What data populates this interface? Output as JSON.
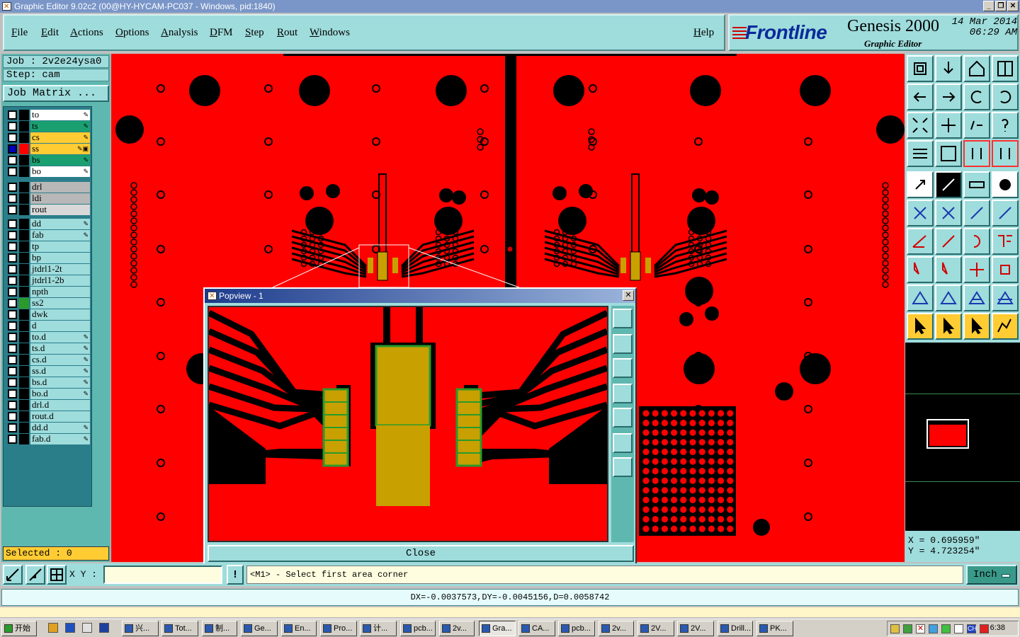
{
  "window": {
    "title": "Graphic Editor 9.02c2 (00@HY-HYCAM-PC037 - Windows, pid:1840)"
  },
  "menu": [
    "File",
    "Edit",
    "Actions",
    "Options",
    "Analysis",
    "DFM",
    "Step",
    "Rout",
    "Windows"
  ],
  "menu_help": "Help",
  "brand": {
    "logo": "Frontline",
    "product": "Genesis 2000",
    "subtitle": "Graphic Editor",
    "date": "14 Mar 2014",
    "time": "06:29 AM"
  },
  "job": {
    "job_line": "Job : 2v2e24ysa0",
    "step_line": "Step: cam",
    "matrix_button": "Job Matrix ..."
  },
  "layers": [
    {
      "name": "to",
      "color": "#ffffff",
      "swatch": "#000000",
      "mark": "✎"
    },
    {
      "name": "ts",
      "color": "#1aa070",
      "swatch": "#000000",
      "mark": "✎"
    },
    {
      "name": "cs",
      "color": "#ffcc33",
      "swatch": "#000000",
      "mark": "✎"
    },
    {
      "name": "ss",
      "color": "#ffcc33",
      "swatch": "#ff0000",
      "mark": "✎▣",
      "active": true
    },
    {
      "name": "bs",
      "color": "#1aa070",
      "swatch": "#000000",
      "mark": "✎"
    },
    {
      "name": "bo",
      "color": "#ffffff",
      "swatch": "#000000",
      "mark": "✎"
    },
    {
      "name": "drl",
      "color": "#b8b8b8",
      "swatch": "#000000",
      "mark": ""
    },
    {
      "name": "ldi",
      "color": "#b8b8b8",
      "swatch": "#000000",
      "mark": ""
    },
    {
      "name": "rout",
      "color": "#d8d8d8",
      "swatch": "#000000",
      "mark": ""
    },
    {
      "name": "dd",
      "color": "#9fdcdc",
      "swatch": "#000000",
      "mark": "✎"
    },
    {
      "name": "fab",
      "color": "#9fdcdc",
      "swatch": "#000000",
      "mark": "✎"
    },
    {
      "name": "tp",
      "color": "#9fdcdc",
      "swatch": "#000000",
      "mark": ""
    },
    {
      "name": "bp",
      "color": "#9fdcdc",
      "swatch": "#000000",
      "mark": ""
    },
    {
      "name": "jtdrl1-2t",
      "color": "#9fdcdc",
      "swatch": "#000000",
      "mark": ""
    },
    {
      "name": "jtdrl1-2b",
      "color": "#9fdcdc",
      "swatch": "#000000",
      "mark": ""
    },
    {
      "name": "npth",
      "color": "#9fdcdc",
      "swatch": "#000000",
      "mark": ""
    },
    {
      "name": "ss2",
      "color": "#9fdcdc",
      "swatch": "#2a9a2a",
      "mark": ""
    },
    {
      "name": "dwk",
      "color": "#9fdcdc",
      "swatch": "#000000",
      "mark": ""
    },
    {
      "name": "d",
      "color": "#9fdcdc",
      "swatch": "#000000",
      "mark": ""
    },
    {
      "name": "to.d",
      "color": "#9fdcdc",
      "swatch": "#000000",
      "mark": "✎"
    },
    {
      "name": "ts.d",
      "color": "#9fdcdc",
      "swatch": "#000000",
      "mark": "✎"
    },
    {
      "name": "cs.d",
      "color": "#9fdcdc",
      "swatch": "#000000",
      "mark": "✎"
    },
    {
      "name": "ss.d",
      "color": "#9fdcdc",
      "swatch": "#000000",
      "mark": "✎"
    },
    {
      "name": "bs.d",
      "color": "#9fdcdc",
      "swatch": "#000000",
      "mark": "✎"
    },
    {
      "name": "bo.d",
      "color": "#9fdcdc",
      "swatch": "#000000",
      "mark": "✎"
    },
    {
      "name": "drl.d",
      "color": "#9fdcdc",
      "swatch": "#000000",
      "mark": ""
    },
    {
      "name": "rout.d",
      "color": "#9fdcdc",
      "swatch": "#000000",
      "mark": ""
    },
    {
      "name": "dd.d",
      "color": "#9fdcdc",
      "swatch": "#000000",
      "mark": "✎"
    },
    {
      "name": "fab.d",
      "color": "#9fdcdc",
      "swatch": "#000000",
      "mark": "✎"
    }
  ],
  "selected": "Selected : 0",
  "popview": {
    "title": "Popview - 1",
    "close_label": "Close"
  },
  "coords": {
    "x": "X = 0.695959\"",
    "y": "Y = 4.723254\""
  },
  "command": {
    "xy_label": "X Y :",
    "xy_value": "",
    "prompt": "<M1> - Select first area corner",
    "units": "Inch"
  },
  "status": "DX=-0.0037573,DY=-0.0045156,D=0.0058742",
  "taskbar": {
    "start": "开始",
    "tasks": [
      "兴...",
      "Tot...",
      "制...",
      "Ge...",
      "En...",
      "Pro...",
      "计...",
      "pcb...",
      "2v...",
      "Gra...",
      "CA...",
      "pcb...",
      "2v...",
      "2V...",
      "2V...",
      "Drill...",
      "PK..."
    ],
    "clock": "6:38"
  },
  "colors": {
    "board": "#ff0000",
    "copper_void": "#000000",
    "pad": "#c8a000",
    "pad_outline": "#2a9a2a",
    "panel": "#9fdcdc"
  }
}
